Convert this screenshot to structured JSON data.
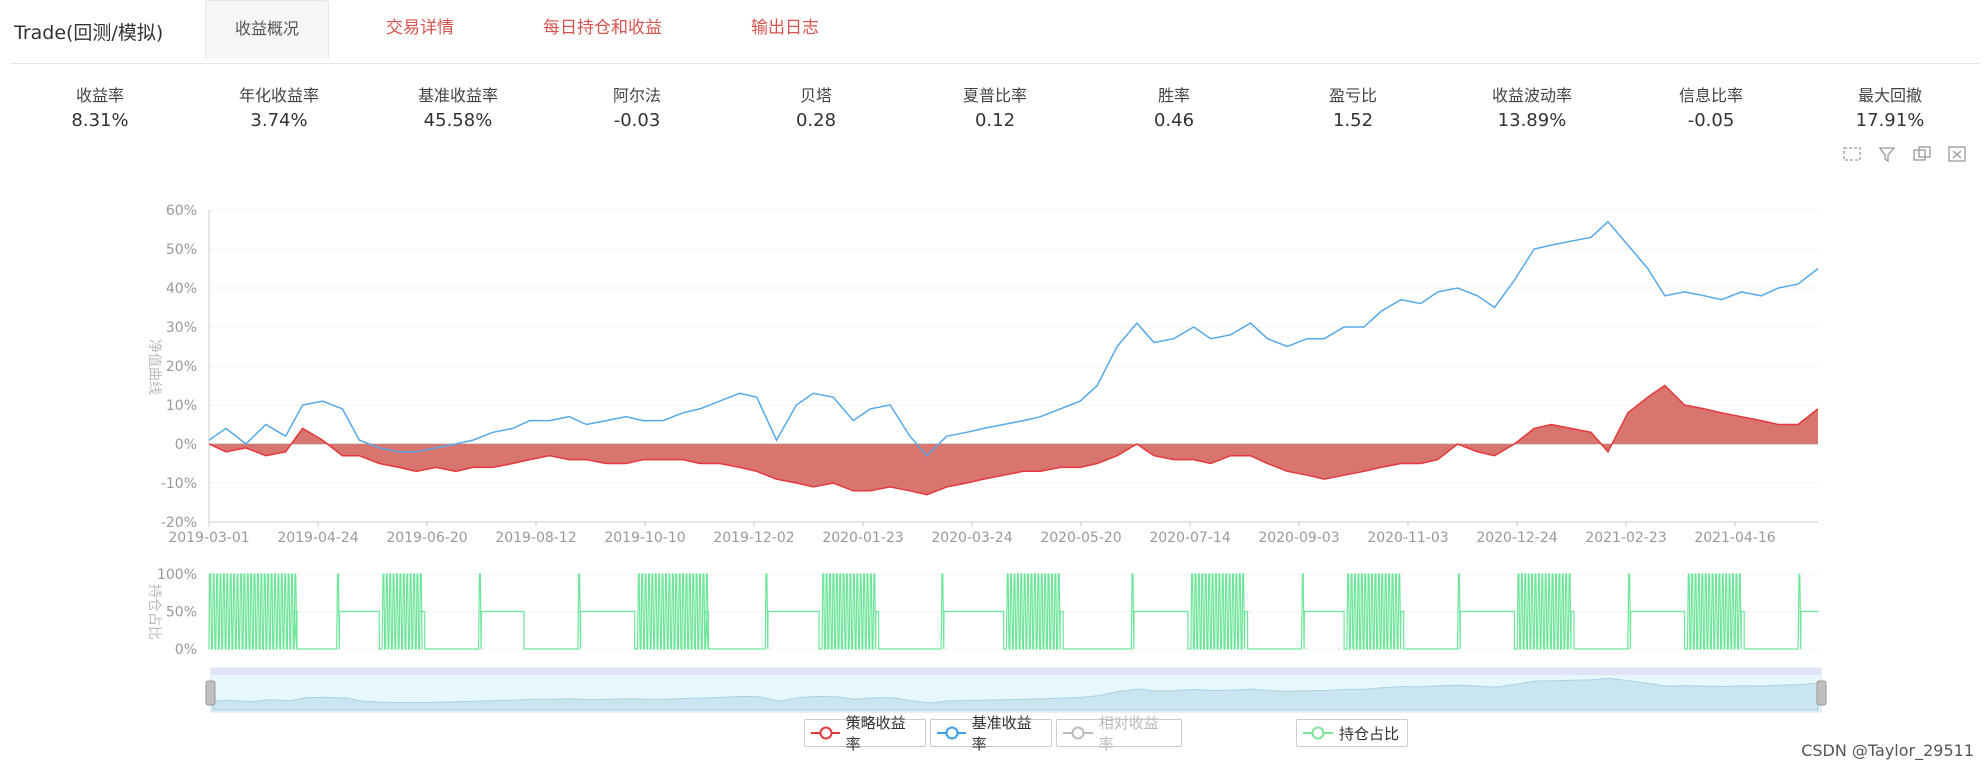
{
  "app": {
    "title": "Trade(回测/模拟)"
  },
  "tabs": [
    {
      "label": "收益概况",
      "active": true
    },
    {
      "label": "交易详情",
      "active": false
    },
    {
      "label": "每日持仓和收益",
      "active": false
    },
    {
      "label": "输出日志",
      "active": false
    }
  ],
  "metrics": [
    {
      "label": "收益率",
      "value": "8.31%"
    },
    {
      "label": "年化收益率",
      "value": "3.74%"
    },
    {
      "label": "基准收益率",
      "value": "45.58%"
    },
    {
      "label": "阿尔法",
      "value": "-0.03"
    },
    {
      "label": "贝塔",
      "value": "0.28"
    },
    {
      "label": "夏普比率",
      "value": "0.12"
    },
    {
      "label": "胜率",
      "value": "0.46"
    },
    {
      "label": "盈亏比",
      "value": "1.52"
    },
    {
      "label": "收益波动率",
      "value": "13.89%"
    },
    {
      "label": "信息比率",
      "value": "-0.05"
    },
    {
      "label": "最大回撤",
      "value": "17.91%"
    }
  ],
  "toolbox": [
    "zoom-area-icon",
    "zoom-reset-icon",
    "restore-icon",
    "save-image-icon"
  ],
  "legend": [
    {
      "label": "策略收益率",
      "color": "#e4393c",
      "enabled": true
    },
    {
      "label": "基准收益率",
      "color": "#3ba0e6",
      "enabled": true
    },
    {
      "label": "相对收益率",
      "color": "#bbbbbb",
      "enabled": false
    },
    {
      "label": "持仓占比",
      "color": "#7be39a",
      "enabled": true
    }
  ],
  "watermark": "CSDN @Taylor_29511",
  "colors": {
    "strategy_line": "#e4393c",
    "strategy_fill": "#d9756f",
    "benchmark_line": "#56a8e8",
    "position_line": "#6ee69a",
    "axis_text": "#999999"
  },
  "chart_data": [
    {
      "type": "area",
      "ylabel": "净值曲线",
      "y_ticks": [
        "60%",
        "50%",
        "40%",
        "30%",
        "20%",
        "10%",
        "0%",
        "-10%",
        "-20%"
      ],
      "ylim": [
        -20,
        60
      ],
      "x_ticks": [
        "2019-03-01",
        "2019-04-24",
        "2019-06-20",
        "2019-08-12",
        "2019-10-10",
        "2019-12-02",
        "2020-01-23",
        "2020-03-24",
        "2020-05-20",
        "2020-07-14",
        "2020-09-03",
        "2020-11-03",
        "2020-12-24",
        "2021-02-23",
        "2021-04-16"
      ],
      "grid": true,
      "series": [
        {
          "name": "基准收益率",
          "x": [
            0,
            6,
            13,
            20,
            27,
            33,
            40,
            47,
            53,
            60,
            67,
            73,
            80,
            87,
            93,
            100,
            107,
            113,
            120,
            127,
            133,
            140,
            147,
            153,
            160,
            167,
            173,
            180,
            187,
            193,
            200,
            207,
            213,
            220,
            227,
            233,
            240,
            247,
            253,
            260,
            267,
            273,
            280,
            287,
            293,
            300,
            307,
            313,
            320,
            327,
            333,
            340,
            347,
            353,
            360,
            367,
            373,
            380,
            387,
            393,
            400,
            407,
            413,
            420,
            427,
            433,
            440,
            447,
            453,
            460,
            467,
            473,
            480,
            487,
            493,
            500,
            507,
            513,
            520,
            527,
            533,
            540,
            547,
            553,
            560,
            567
          ],
          "y": [
            1,
            4,
            0,
            5,
            2,
            10,
            11,
            9,
            1,
            -1,
            -2,
            -2,
            -1,
            0,
            1,
            3,
            4,
            6,
            6,
            7,
            5,
            6,
            7,
            6,
            6,
            8,
            9,
            11,
            13,
            12,
            1,
            10,
            13,
            12,
            6,
            9,
            10,
            2,
            -3,
            2,
            3,
            4,
            5,
            6,
            7,
            9,
            11,
            15,
            25,
            31,
            26,
            27,
            30,
            27,
            28,
            31,
            27,
            25,
            27,
            27,
            30,
            30,
            34,
            37,
            36,
            39,
            40,
            38,
            35,
            42,
            50,
            51,
            52,
            53,
            57,
            51,
            45,
            38,
            39,
            38,
            37,
            39,
            38,
            40,
            41,
            45
          ]
        },
        {
          "name": "策略收益率",
          "x": [
            0,
            6,
            13,
            20,
            27,
            33,
            40,
            47,
            53,
            60,
            67,
            73,
            80,
            87,
            93,
            100,
            107,
            113,
            120,
            127,
            133,
            140,
            147,
            153,
            160,
            167,
            173,
            180,
            187,
            193,
            200,
            207,
            213,
            220,
            227,
            233,
            240,
            247,
            253,
            260,
            267,
            273,
            280,
            287,
            293,
            300,
            307,
            313,
            320,
            327,
            333,
            340,
            347,
            353,
            360,
            367,
            373,
            380,
            387,
            393,
            400,
            407,
            413,
            420,
            427,
            433,
            440,
            447,
            453,
            460,
            467,
            473,
            480,
            487,
            493,
            500,
            507,
            513,
            520,
            527,
            533,
            540,
            547,
            553,
            560,
            567
          ],
          "y": [
            0,
            -2,
            -1,
            -3,
            -2,
            4,
            1,
            -3,
            -3,
            -5,
            -6,
            -7,
            -6,
            -7,
            -6,
            -6,
            -5,
            -4,
            -3,
            -4,
            -4,
            -5,
            -5,
            -4,
            -4,
            -4,
            -5,
            -5,
            -6,
            -7,
            -9,
            -10,
            -11,
            -10,
            -12,
            -12,
            -11,
            -12,
            -13,
            -11,
            -10,
            -9,
            -8,
            -7,
            -7,
            -6,
            -6,
            -5,
            -3,
            0,
            -3,
            -4,
            -4,
            -5,
            -3,
            -3,
            -5,
            -7,
            -8,
            -9,
            -8,
            -7,
            -6,
            -5,
            -5,
            -4,
            0,
            -2,
            -3,
            0,
            4,
            5,
            4,
            3,
            -2,
            8,
            12,
            15,
            10,
            9,
            8,
            7,
            6,
            5,
            5,
            9
          ]
        },
        {
          "name": "持仓占比",
          "x": [
            0,
            30,
            31,
            45,
            46,
            60,
            61,
            75,
            76,
            95,
            96,
            110,
            111,
            130,
            131,
            150,
            151,
            175,
            176,
            196,
            197,
            215,
            216,
            235,
            236,
            258,
            259,
            280,
            281,
            300,
            301,
            325,
            326,
            345,
            346,
            365,
            366,
            385,
            386,
            400,
            401,
            420,
            421,
            440,
            441,
            460,
            461,
            480,
            481,
            500,
            501,
            520,
            521,
            540,
            541,
            560,
            561,
            567
          ],
          "y": [
            100,
            50,
            0,
            100,
            50,
            0,
            100,
            50,
            0,
            100,
            50,
            50,
            0,
            100,
            50,
            0,
            100,
            50,
            0,
            100,
            50,
            0,
            100,
            50,
            0,
            100,
            50,
            0,
            100,
            50,
            0,
            100,
            50,
            0,
            100,
            50,
            0,
            100,
            50,
            0,
            100,
            50,
            0,
            100,
            50,
            0,
            100,
            50,
            0,
            100,
            50,
            0,
            100,
            50,
            0,
            100,
            50,
            50
          ]
        }
      ]
    },
    {
      "type": "area",
      "ylabel": "持仓占比",
      "y_ticks": [
        "100%",
        "50%",
        "0%"
      ],
      "ylim": [
        0,
        100
      ]
    }
  ]
}
